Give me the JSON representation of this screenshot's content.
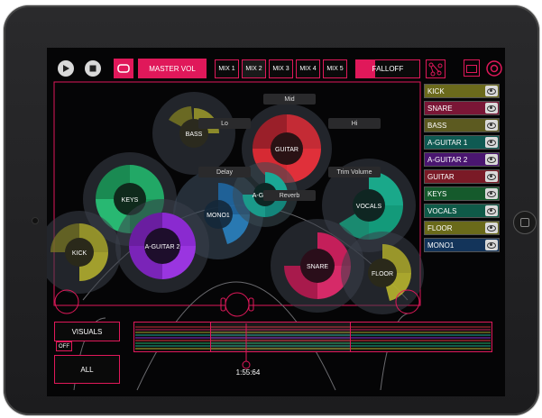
{
  "toolbar": {
    "master_vol_label": "MASTER VOL",
    "falloff_label": "FALLOFF",
    "mix_tabs": [
      {
        "label": "MIX 1",
        "selected": false
      },
      {
        "label": "MIX 2",
        "selected": true
      },
      {
        "label": "MIX 3",
        "selected": false
      },
      {
        "label": "MIX 4",
        "selected": false
      },
      {
        "label": "MIX 5",
        "selected": false
      }
    ]
  },
  "tracks": [
    {
      "label": "KICK",
      "color": "#6b6a1c"
    },
    {
      "label": "SNARE",
      "color": "#7a1636"
    },
    {
      "label": "BASS",
      "color": "#5c5a20"
    },
    {
      "label": "A-GUITAR 1",
      "color": "#0f5a52"
    },
    {
      "label": "A-GUITAR 2",
      "color": "#4a1670"
    },
    {
      "label": "GUITAR",
      "color": "#7a1a26"
    },
    {
      "label": "KEYS",
      "color": "#155a2c"
    },
    {
      "label": "VOCALS",
      "color": "#0f5a48"
    },
    {
      "label": "FLOOR",
      "color": "#6a6a1a"
    },
    {
      "label": "MONO1",
      "color": "#13345a"
    }
  ],
  "nodes": {
    "bass": "BASS",
    "guitar": "GUITAR",
    "keys": "KEYS",
    "mono1": "MONO1",
    "a_g": "A-G",
    "vocals": "VOCALS",
    "kick": "KICK",
    "a_guitar_2": "A-GUITAR 2",
    "snare": "SNARE",
    "floor": "FLOOR"
  },
  "effects": {
    "mid": "Mid",
    "lo": "Lo",
    "hi": "Hi",
    "delay": "Delay",
    "trim_volume": "Trim Volume",
    "reverb": "Reverb"
  },
  "bottom": {
    "visuals_label": "VISUALS",
    "visuals_state": "OFF",
    "all_label": "ALL",
    "time": "1:55:64"
  },
  "colors": {
    "accent": "#e0185a"
  }
}
